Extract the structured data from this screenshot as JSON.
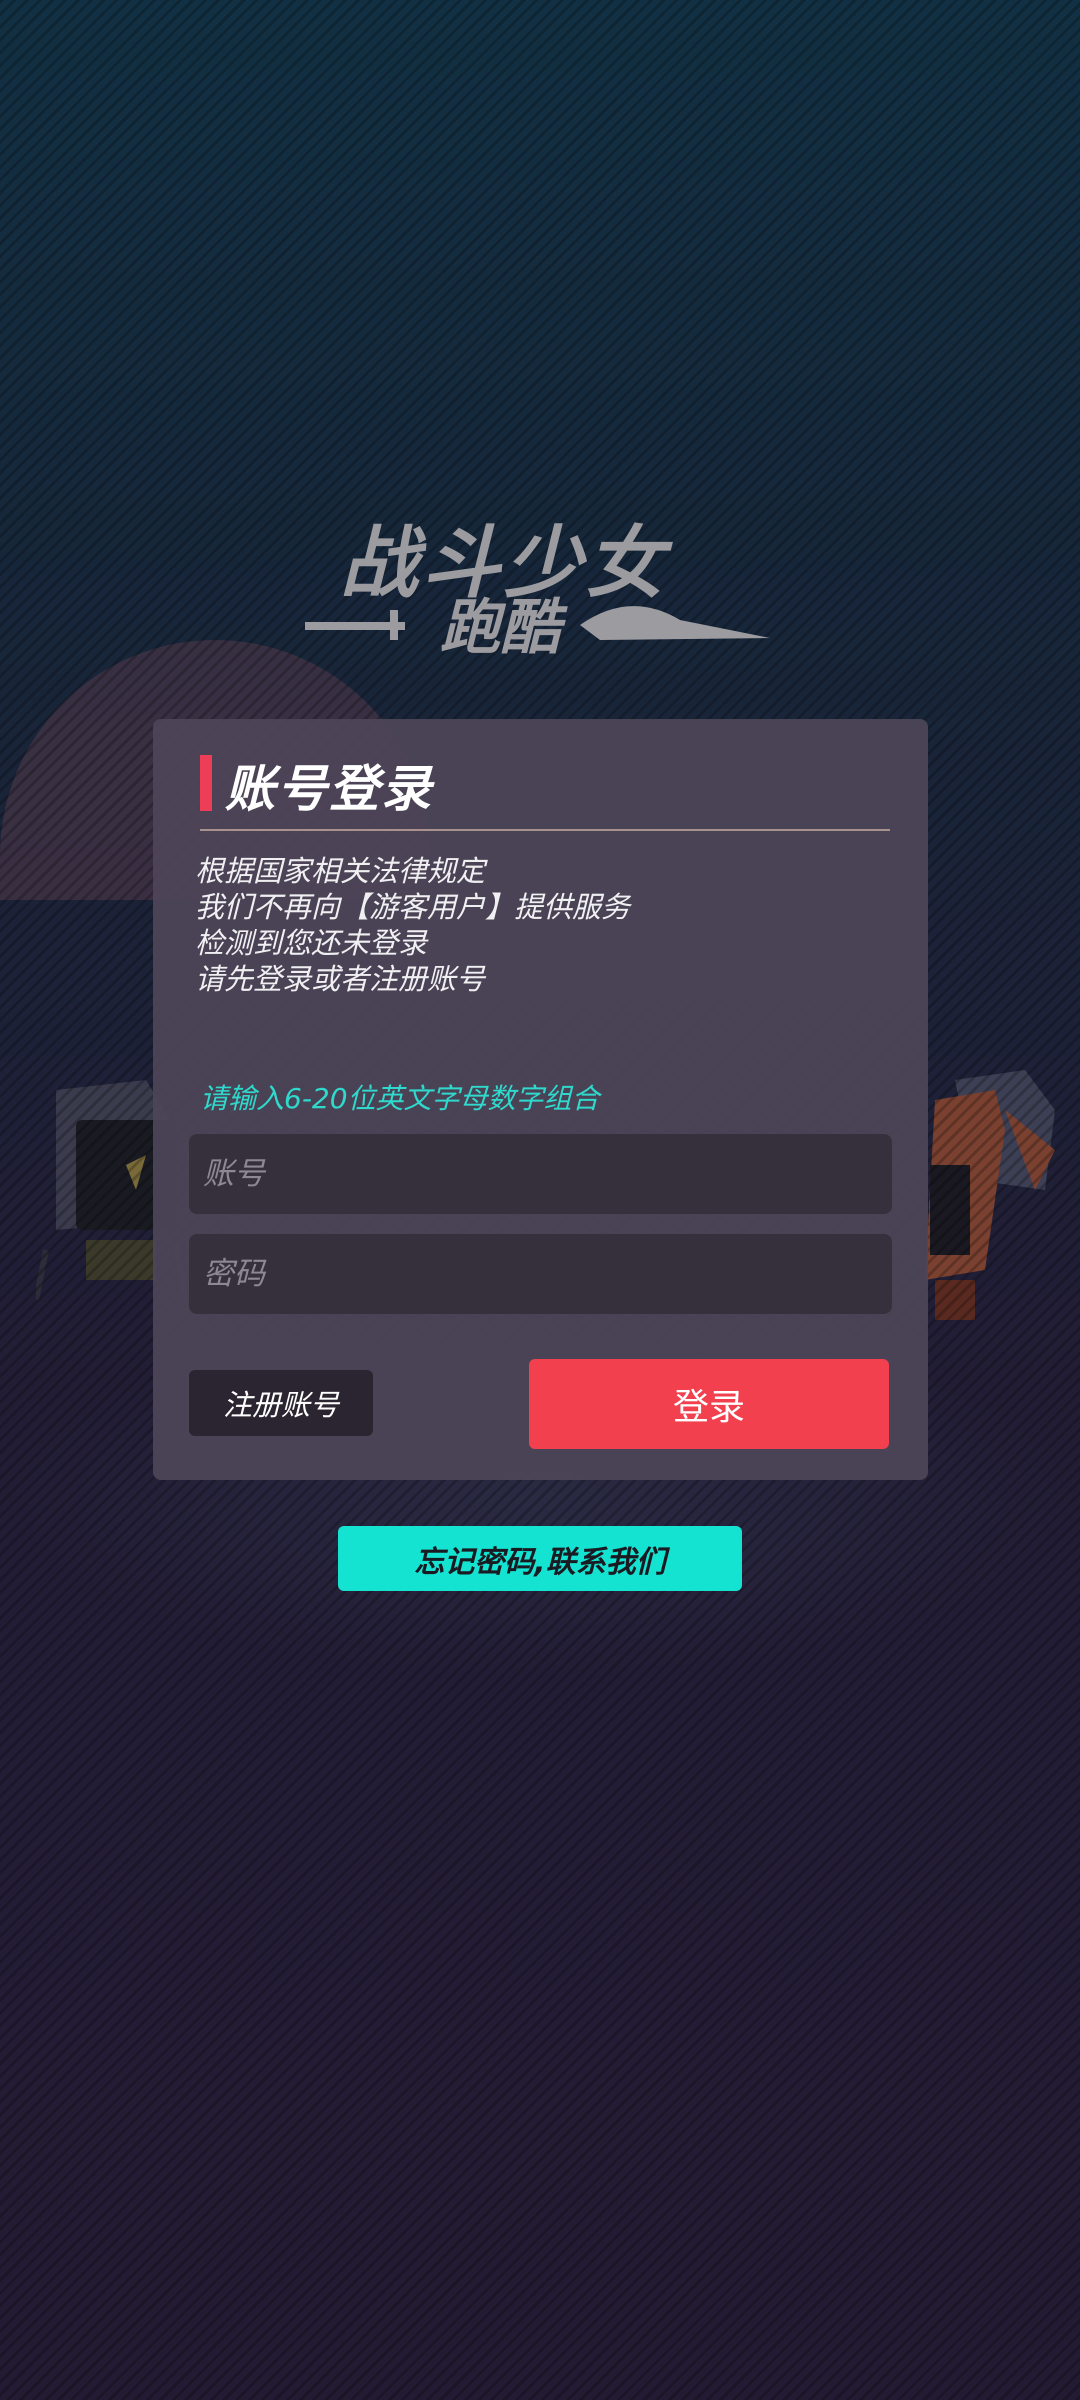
{
  "logo": {
    "line1": "战斗少女",
    "line2": "跑酷"
  },
  "login_panel": {
    "title": "账号登录",
    "notice_lines": [
      "根据国家相关法律规定",
      "我们不再向【游客用户】提供服务",
      "检测到您还未登录",
      "请先登录或者注册账号"
    ],
    "hint": "请输入6-20位英文字母数字组合",
    "account_field": {
      "placeholder": "账号",
      "value": ""
    },
    "password_field": {
      "placeholder": "密码",
      "value": ""
    },
    "register_label": "注册账号",
    "login_label": "登录"
  },
  "forgot_label": "忘记密码,联系我们",
  "colors": {
    "accent_red": "#f2404f",
    "accent_cyan": "#14e3d1",
    "panel_bg": "#4e4658"
  }
}
